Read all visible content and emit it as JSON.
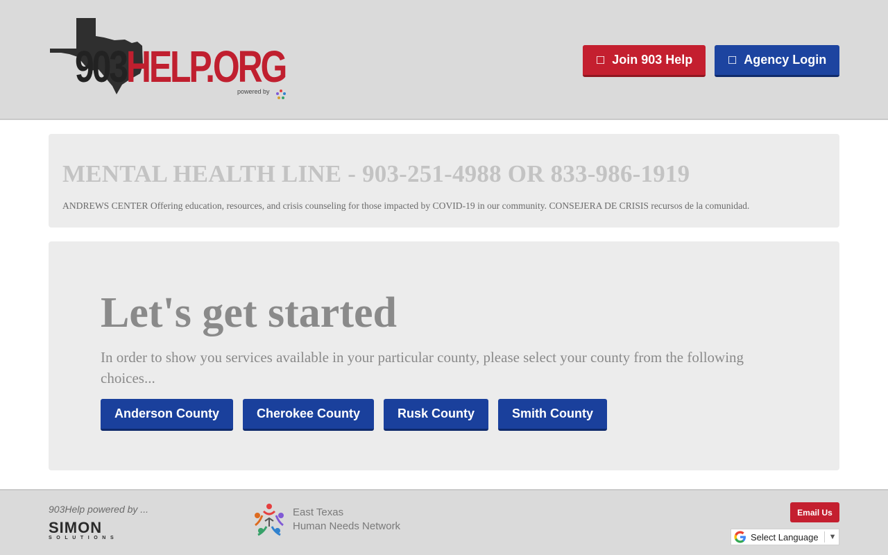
{
  "header": {
    "logo_main": "903",
    "logo_accent": "HELP.ORG",
    "logo_powered": "powered by",
    "join_label": "Join 903 Help",
    "join_icon": "user-plus-icon",
    "login_label": "Agency Login",
    "login_icon": "lock-icon"
  },
  "alert": {
    "title": "MENTAL HEALTH LINE - 903-251-4988 OR 833-986-1919",
    "text": "ANDREWS CENTER Offering education, resources, and crisis counseling for those impacted by COVID-19 in our community. CONSEJERA DE CRISIS recursos de la comunidad."
  },
  "main": {
    "title": "Let's get started",
    "text": "In order to show you services available in your particular county, please select your county from the following choices...",
    "counties": [
      "Anderson County",
      "Cherokee County",
      "Rusk County",
      "Smith County"
    ]
  },
  "footer": {
    "powered_by": "903Help powered by ...",
    "simon_name": "SIMON",
    "simon_sub": "SOLUTIONS",
    "etn_line1": "East Texas",
    "etn_line2": "Human Needs Network",
    "email_label": "Email Us",
    "language_label": "Select Language",
    "language_arrow": "▼"
  },
  "colors": {
    "brand_red": "#c41f2f",
    "brand_blue": "#1d44a0",
    "header_bg": "#dadada",
    "panel_bg": "#ececec"
  }
}
